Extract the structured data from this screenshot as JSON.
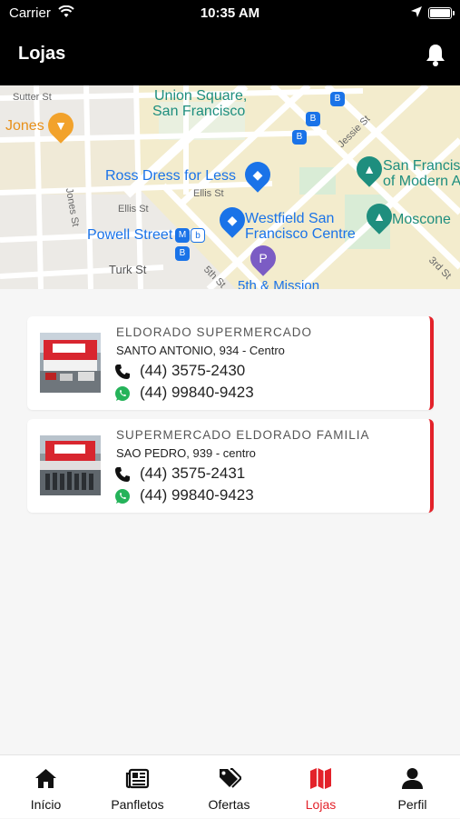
{
  "status_bar": {
    "carrier": "Carrier",
    "time": "10:35 AM"
  },
  "header": {
    "title": "Lojas",
    "notification_icon": "bell-icon"
  },
  "map": {
    "labels": {
      "union_square": "Union Square,",
      "san_francisco": "San Francisco",
      "jones": "Jones",
      "ross": "Ross Dress for Less",
      "sf_museum_1": "San Francis",
      "sf_museum_2": "of Modern A",
      "westfield_1": "Westfield San",
      "westfield_2": "Francisco Centre",
      "moscone": "Moscone",
      "powell": "Powell Street",
      "turk": "Turk St",
      "fifth_mission": "5th & Mission",
      "sutter": "Sutter St",
      "ellis": "Ellis St",
      "ellis2": "Ellis St",
      "jones_st": "Jones St",
      "jessie": "Jessie St",
      "third": "3rd St",
      "fifth": "5th St"
    }
  },
  "stores": [
    {
      "name": "ELDORADO SUPERMERCADO",
      "address": "SANTO ANTONIO, 934 - Centro",
      "phone": "(44) 3575-2430",
      "whatsapp": "(44) 99840-9423"
    },
    {
      "name": "SUPERMERCADO ELDORADO FAMILIA",
      "address": "SAO PEDRO, 939 - centro",
      "phone": "(44) 3575-2431",
      "whatsapp": "(44) 99840-9423"
    }
  ],
  "tabs": [
    {
      "label": "Início",
      "icon": "home-icon"
    },
    {
      "label": "Panfletos",
      "icon": "newspaper-icon"
    },
    {
      "label": "Ofertas",
      "icon": "tags-icon"
    },
    {
      "label": "Lojas",
      "icon": "map-icon"
    },
    {
      "label": "Perfil",
      "icon": "user-icon"
    }
  ],
  "colors": {
    "accent": "#e3222a",
    "header_bg": "#000000",
    "map_blue": "#1a73e8",
    "map_teal": "#1e8e7e"
  }
}
